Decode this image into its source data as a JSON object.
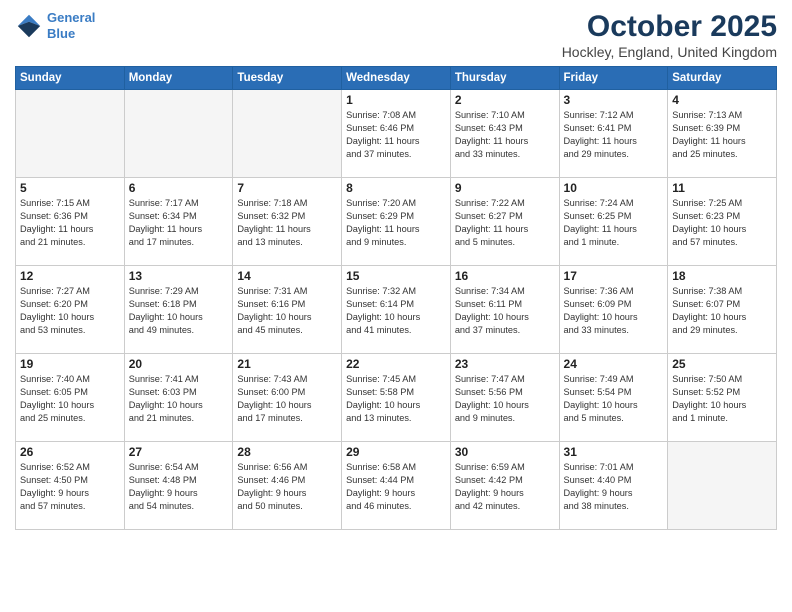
{
  "header": {
    "logo_line1": "General",
    "logo_line2": "Blue",
    "month_title": "October 2025",
    "location": "Hockley, England, United Kingdom"
  },
  "days_of_week": [
    "Sunday",
    "Monday",
    "Tuesday",
    "Wednesday",
    "Thursday",
    "Friday",
    "Saturday"
  ],
  "weeks": [
    [
      {
        "day": "",
        "info": ""
      },
      {
        "day": "",
        "info": ""
      },
      {
        "day": "",
        "info": ""
      },
      {
        "day": "1",
        "info": "Sunrise: 7:08 AM\nSunset: 6:46 PM\nDaylight: 11 hours\nand 37 minutes."
      },
      {
        "day": "2",
        "info": "Sunrise: 7:10 AM\nSunset: 6:43 PM\nDaylight: 11 hours\nand 33 minutes."
      },
      {
        "day": "3",
        "info": "Sunrise: 7:12 AM\nSunset: 6:41 PM\nDaylight: 11 hours\nand 29 minutes."
      },
      {
        "day": "4",
        "info": "Sunrise: 7:13 AM\nSunset: 6:39 PM\nDaylight: 11 hours\nand 25 minutes."
      }
    ],
    [
      {
        "day": "5",
        "info": "Sunrise: 7:15 AM\nSunset: 6:36 PM\nDaylight: 11 hours\nand 21 minutes."
      },
      {
        "day": "6",
        "info": "Sunrise: 7:17 AM\nSunset: 6:34 PM\nDaylight: 11 hours\nand 17 minutes."
      },
      {
        "day": "7",
        "info": "Sunrise: 7:18 AM\nSunset: 6:32 PM\nDaylight: 11 hours\nand 13 minutes."
      },
      {
        "day": "8",
        "info": "Sunrise: 7:20 AM\nSunset: 6:29 PM\nDaylight: 11 hours\nand 9 minutes."
      },
      {
        "day": "9",
        "info": "Sunrise: 7:22 AM\nSunset: 6:27 PM\nDaylight: 11 hours\nand 5 minutes."
      },
      {
        "day": "10",
        "info": "Sunrise: 7:24 AM\nSunset: 6:25 PM\nDaylight: 11 hours\nand 1 minute."
      },
      {
        "day": "11",
        "info": "Sunrise: 7:25 AM\nSunset: 6:23 PM\nDaylight: 10 hours\nand 57 minutes."
      }
    ],
    [
      {
        "day": "12",
        "info": "Sunrise: 7:27 AM\nSunset: 6:20 PM\nDaylight: 10 hours\nand 53 minutes."
      },
      {
        "day": "13",
        "info": "Sunrise: 7:29 AM\nSunset: 6:18 PM\nDaylight: 10 hours\nand 49 minutes."
      },
      {
        "day": "14",
        "info": "Sunrise: 7:31 AM\nSunset: 6:16 PM\nDaylight: 10 hours\nand 45 minutes."
      },
      {
        "day": "15",
        "info": "Sunrise: 7:32 AM\nSunset: 6:14 PM\nDaylight: 10 hours\nand 41 minutes."
      },
      {
        "day": "16",
        "info": "Sunrise: 7:34 AM\nSunset: 6:11 PM\nDaylight: 10 hours\nand 37 minutes."
      },
      {
        "day": "17",
        "info": "Sunrise: 7:36 AM\nSunset: 6:09 PM\nDaylight: 10 hours\nand 33 minutes."
      },
      {
        "day": "18",
        "info": "Sunrise: 7:38 AM\nSunset: 6:07 PM\nDaylight: 10 hours\nand 29 minutes."
      }
    ],
    [
      {
        "day": "19",
        "info": "Sunrise: 7:40 AM\nSunset: 6:05 PM\nDaylight: 10 hours\nand 25 minutes."
      },
      {
        "day": "20",
        "info": "Sunrise: 7:41 AM\nSunset: 6:03 PM\nDaylight: 10 hours\nand 21 minutes."
      },
      {
        "day": "21",
        "info": "Sunrise: 7:43 AM\nSunset: 6:00 PM\nDaylight: 10 hours\nand 17 minutes."
      },
      {
        "day": "22",
        "info": "Sunrise: 7:45 AM\nSunset: 5:58 PM\nDaylight: 10 hours\nand 13 minutes."
      },
      {
        "day": "23",
        "info": "Sunrise: 7:47 AM\nSunset: 5:56 PM\nDaylight: 10 hours\nand 9 minutes."
      },
      {
        "day": "24",
        "info": "Sunrise: 7:49 AM\nSunset: 5:54 PM\nDaylight: 10 hours\nand 5 minutes."
      },
      {
        "day": "25",
        "info": "Sunrise: 7:50 AM\nSunset: 5:52 PM\nDaylight: 10 hours\nand 1 minute."
      }
    ],
    [
      {
        "day": "26",
        "info": "Sunrise: 6:52 AM\nSunset: 4:50 PM\nDaylight: 9 hours\nand 57 minutes."
      },
      {
        "day": "27",
        "info": "Sunrise: 6:54 AM\nSunset: 4:48 PM\nDaylight: 9 hours\nand 54 minutes."
      },
      {
        "day": "28",
        "info": "Sunrise: 6:56 AM\nSunset: 4:46 PM\nDaylight: 9 hours\nand 50 minutes."
      },
      {
        "day": "29",
        "info": "Sunrise: 6:58 AM\nSunset: 4:44 PM\nDaylight: 9 hours\nand 46 minutes."
      },
      {
        "day": "30",
        "info": "Sunrise: 6:59 AM\nSunset: 4:42 PM\nDaylight: 9 hours\nand 42 minutes."
      },
      {
        "day": "31",
        "info": "Sunrise: 7:01 AM\nSunset: 4:40 PM\nDaylight: 9 hours\nand 38 minutes."
      },
      {
        "day": "",
        "info": ""
      }
    ]
  ]
}
